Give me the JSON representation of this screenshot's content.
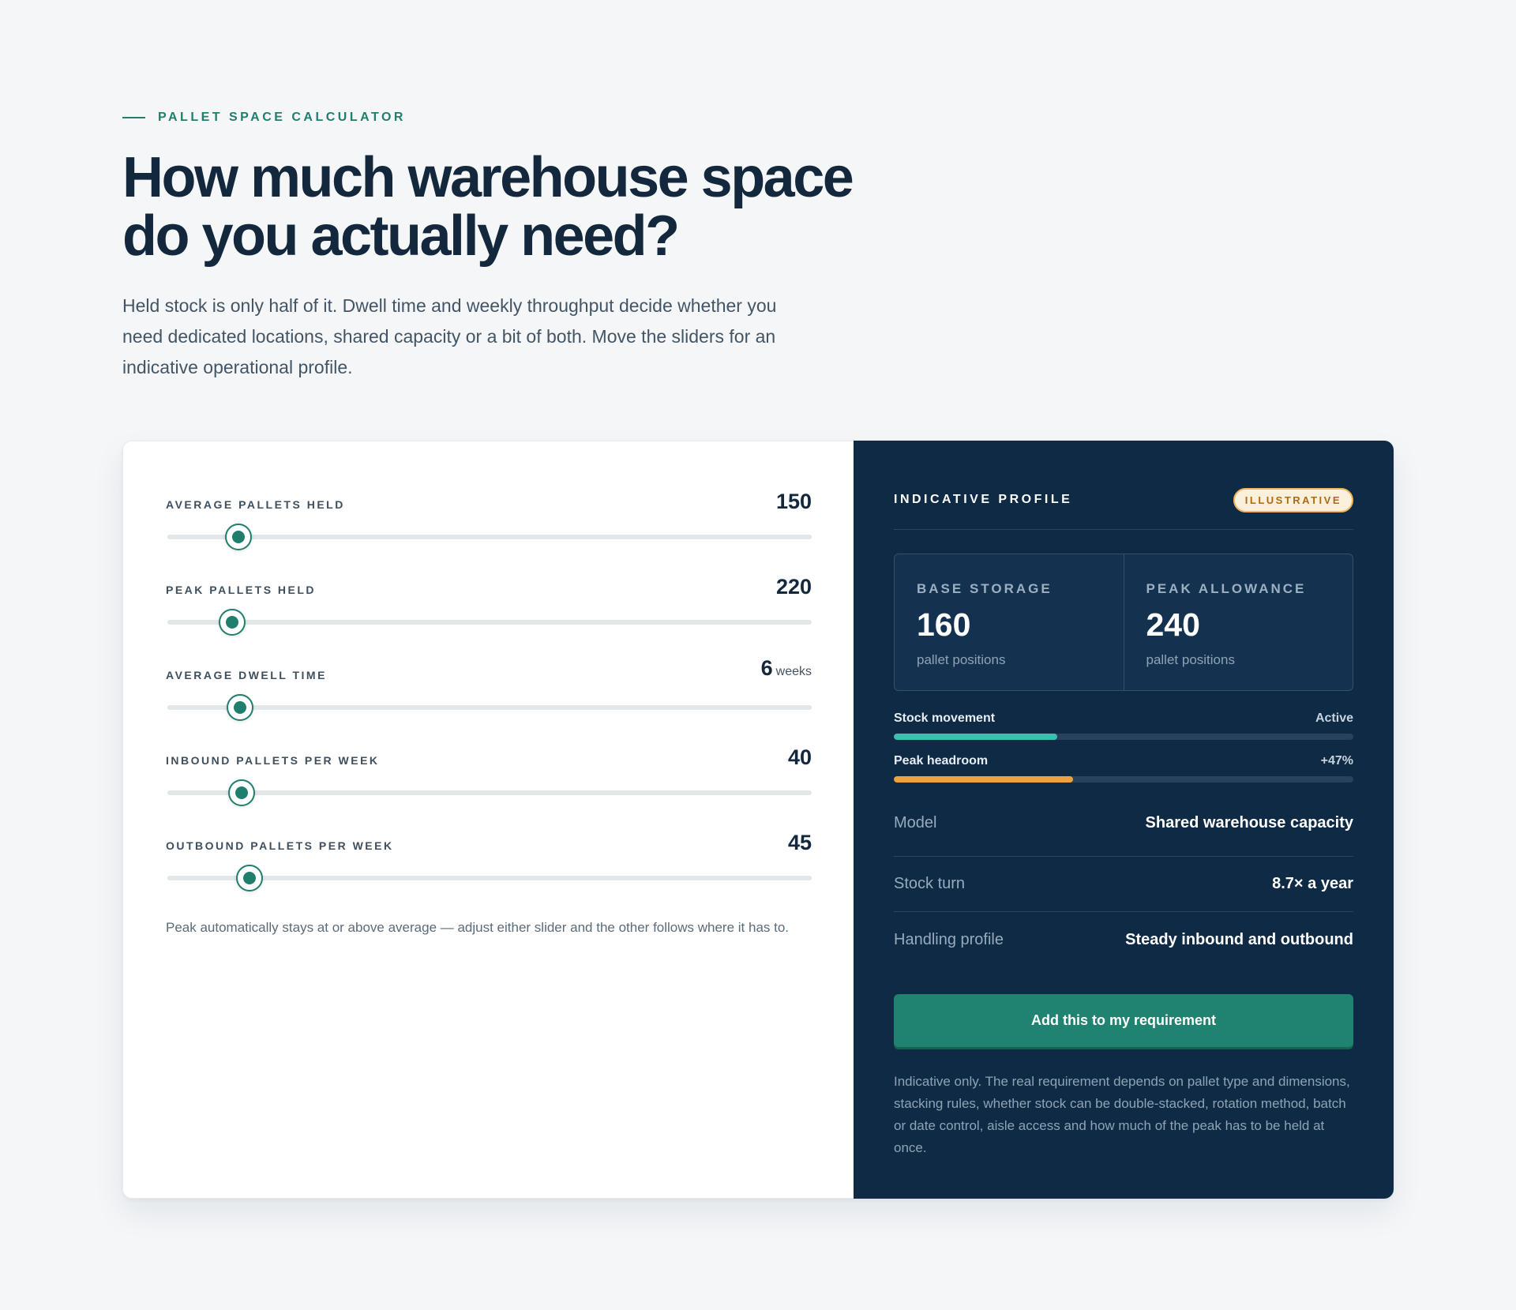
{
  "hero": {
    "eyebrow": "PALLET SPACE CALCULATOR",
    "title": "How much warehouse space do you actually need?",
    "lede": "Held stock is only half of it. Dwell time and weekly throughput decide whether you need dedicated locations, shared capacity or a bit of both. Move the sliders for an indicative operational profile."
  },
  "sliders": [
    {
      "label": "AVERAGE PALLETS HELD",
      "value": "150",
      "unit": "",
      "fraction": 0.11
    },
    {
      "label": "PEAK PALLETS HELD",
      "value": "220",
      "unit": "",
      "fraction": 0.1
    },
    {
      "label": "AVERAGE DWELL TIME",
      "value": "6",
      "unit": "weeks",
      "fraction": 0.113
    },
    {
      "label": "INBOUND PALLETS PER WEEK",
      "value": "40",
      "unit": "",
      "fraction": 0.115
    },
    {
      "label": "OUTBOUND PALLETS PER WEEK",
      "value": "45",
      "unit": "",
      "fraction": 0.128
    }
  ],
  "slider_note": "Peak automatically stays at or above average — adjust either slider and the other follows where it has to.",
  "profile": {
    "title": "INDICATIVE PROFILE",
    "badge": "ILLUSTRATIVE",
    "base": {
      "label": "BASE STORAGE",
      "value": "160",
      "unit": "pallet positions"
    },
    "peak": {
      "label": "PEAK ALLOWANCE",
      "value": "240",
      "unit": "pallet positions"
    },
    "bars": [
      {
        "label": "Stock movement",
        "value": "Active",
        "fraction": 0.355,
        "color": "#3bbfae"
      },
      {
        "label": "Peak headroom",
        "value": "+47%",
        "fraction": 0.39,
        "color": "#f0a13a"
      }
    ],
    "details": [
      {
        "key": "Model",
        "value": "Shared warehouse capacity"
      },
      {
        "key": "Stock turn",
        "value": "8.7× a year"
      },
      {
        "key": "Handling profile",
        "value": "Steady inbound and outbound"
      }
    ],
    "cta": "Add this to my requirement",
    "disclaimer": "Indicative only. The real requirement depends on pallet type and dimensions, stacking rules, whether stock can be double-stacked, rotation method, batch or date control, aisle access and how much of the peak has to be held at once."
  },
  "colors": {
    "accent": "#1f7f6c",
    "panel": "#0e2a45",
    "badge": "#f0b45c"
  }
}
